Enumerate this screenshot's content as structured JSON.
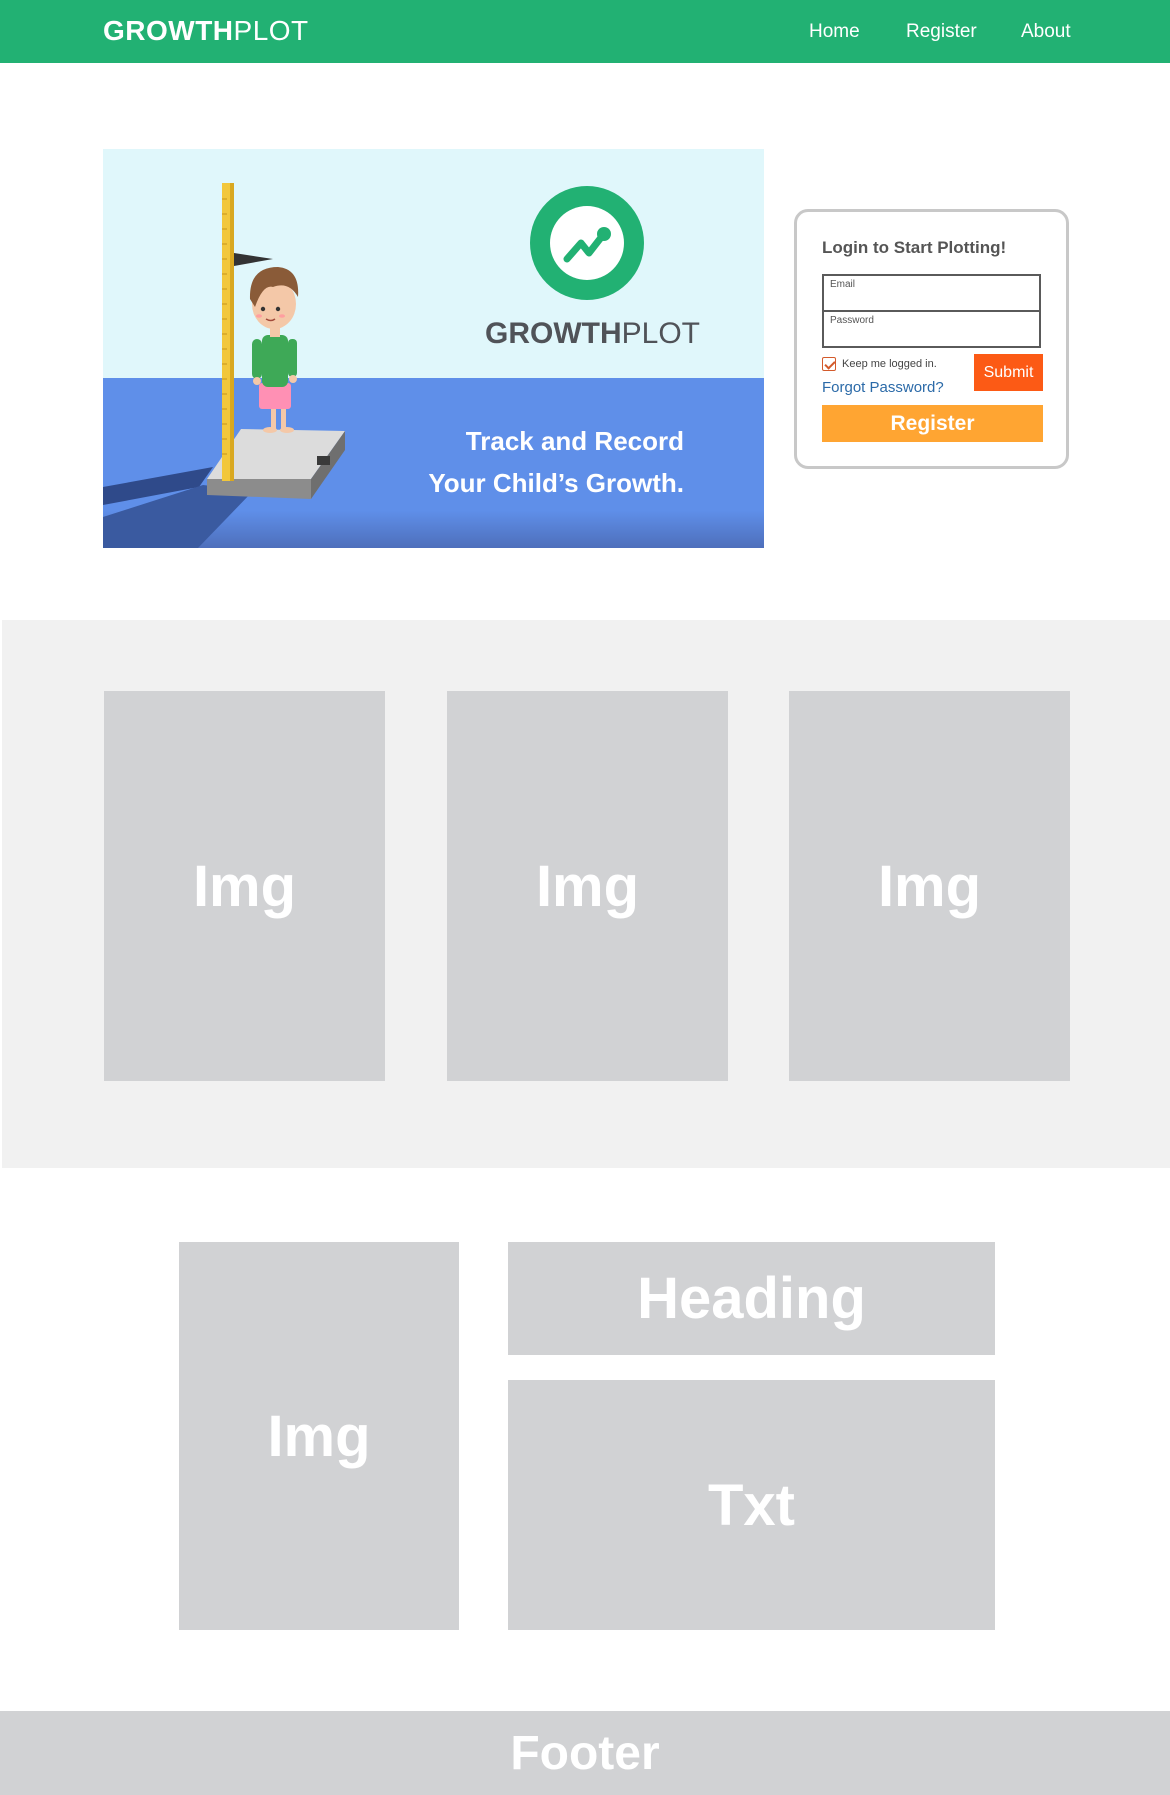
{
  "nav": {
    "brand_bold": "GROWTH",
    "brand_light": "PLOT",
    "links": [
      {
        "label": "Home"
      },
      {
        "label": "Register"
      },
      {
        "label": "About"
      }
    ]
  },
  "hero": {
    "logo_bold": "GROWTH",
    "logo_light": "PLOT",
    "tagline_line1": "Track and Record",
    "tagline_line2": "Your Child’s Growth."
  },
  "login": {
    "title": "Login to Start Plotting!",
    "email_label": "Email",
    "password_label": "Password",
    "keep_logged_in": "Keep me logged in.",
    "forgot_password": "Forgot Password?",
    "submit": "Submit",
    "register": "Register"
  },
  "features": {
    "items": [
      {
        "label": "Img"
      },
      {
        "label": "Img"
      },
      {
        "label": "Img"
      }
    ]
  },
  "content": {
    "image_label": "Img",
    "heading_label": "Heading",
    "text_label": "Txt"
  },
  "footer": {
    "label": "Footer"
  },
  "colors": {
    "brand_green": "#22b173",
    "submit_orange": "#fc5a15",
    "register_orange": "#ffa532",
    "placeholder_gray": "#d1d2d4"
  }
}
